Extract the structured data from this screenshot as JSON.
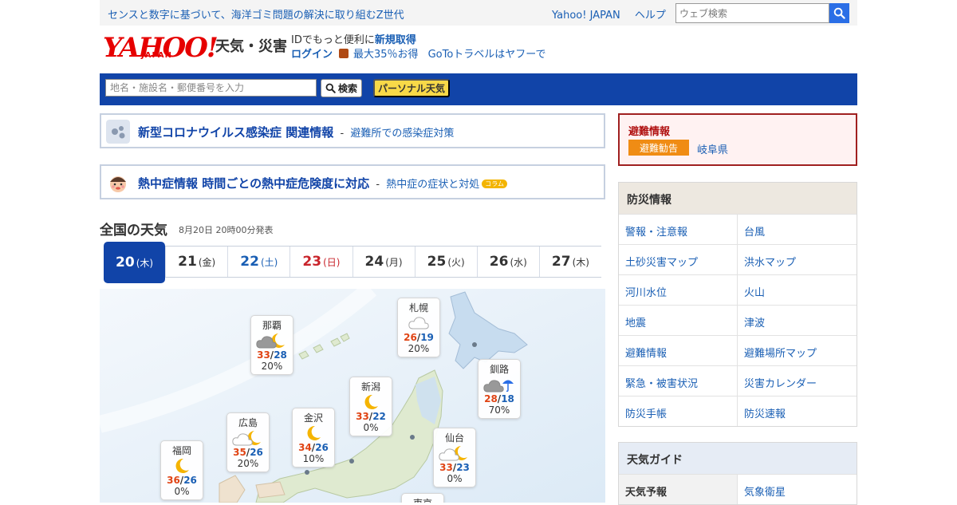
{
  "topbar": {
    "tagline": "センスと数字に基づいて、海洋ゴミ問題の解決に取り組むZ世代",
    "links": [
      "Yahoo! JAPAN",
      "ヘルプ"
    ],
    "search_placeholder": "ウェブ検索"
  },
  "header": {
    "logo_text": "YAHOO!",
    "logo_sub": "JAPAN",
    "service_name": "天気・災害",
    "promo_line1_prefix": "IDでもっと便利に",
    "promo_signup": "新規取得",
    "promo_login": "ログイン",
    "promo_discount": "最大35％お得",
    "promo_travel": "GoToトラベルはヤフーで"
  },
  "searchbar": {
    "placeholder": "地名・施設名・郵便番号を入力",
    "search_label": "検索",
    "personal_label": "パーソナル天気"
  },
  "notices": [
    {
      "title": "新型コロナウイルス感染症 関連情報",
      "sep": "-",
      "sub": "避難所での感染症対策",
      "badge": ""
    },
    {
      "title": "熱中症情報 時間ごとの熱中症危険度に対応",
      "sep": "-",
      "sub": "熱中症の症状と対処",
      "badge": "コラム"
    }
  ],
  "national": {
    "title": "全国の天気",
    "issued": "8月20日 20時00分発表",
    "days": [
      {
        "num": "20",
        "dow": "(木)",
        "kind": "active"
      },
      {
        "num": "21",
        "dow": "(金)",
        "kind": ""
      },
      {
        "num": "22",
        "dow": "(土)",
        "kind": "sat"
      },
      {
        "num": "23",
        "dow": "(日)",
        "kind": "sun"
      },
      {
        "num": "24",
        "dow": "(月)",
        "kind": ""
      },
      {
        "num": "25",
        "dow": "(火)",
        "kind": ""
      },
      {
        "num": "26",
        "dow": "(水)",
        "kind": ""
      },
      {
        "num": "27",
        "dow": "(木)",
        "kind": ""
      }
    ]
  },
  "cities": {
    "sapporo": {
      "name": "札幌",
      "icon": "cloud-icon",
      "hi": "26",
      "lo": "19",
      "pop": "20%"
    },
    "naha": {
      "name": "那覇",
      "icon": "cloud-moon-icon",
      "hi": "33",
      "lo": "28",
      "pop": "20%"
    },
    "kushiro": {
      "name": "釧路",
      "icon": "cloud-umbrella-icon",
      "hi": "28",
      "lo": "18",
      "pop": "70%"
    },
    "niigata": {
      "name": "新潟",
      "icon": "moon-icon",
      "hi": "33",
      "lo": "22",
      "pop": "0%"
    },
    "kanazawa": {
      "name": "金沢",
      "icon": "moon-icon",
      "hi": "34",
      "lo": "26",
      "pop": "10%"
    },
    "hiroshima": {
      "name": "広島",
      "icon": "cloud-moon-icon",
      "hi": "35",
      "lo": "26",
      "pop": "20%"
    },
    "sendai": {
      "name": "仙台",
      "icon": "cloud-moon-icon",
      "hi": "33",
      "lo": "23",
      "pop": "0%"
    },
    "fukuoka": {
      "name": "福岡",
      "icon": "moon-icon",
      "hi": "36",
      "lo": "26",
      "pop": "0%"
    },
    "tokyo": {
      "name": "東京"
    }
  },
  "alert": {
    "title": "避難情報",
    "level": "避難勧告",
    "area": "岐阜県"
  },
  "bousai": {
    "title": "防災情報",
    "items": [
      "警報・注意報",
      "台風",
      "土砂災害マップ",
      "洪水マップ",
      "河川水位",
      "火山",
      "地震",
      "津波",
      "避難情報",
      "避難場所マップ",
      "緊急・被害状況",
      "災害カレンダー",
      "防災手帳",
      "防災速報"
    ]
  },
  "guide": {
    "title": "天気ガイド",
    "items": [
      "天気予報",
      "気象衛星"
    ]
  },
  "colors": {
    "brand_blue": "#1144a8",
    "logo_red": "#e60000",
    "hi_temp": "#e04414",
    "lo_temp": "#1a5fb4"
  }
}
